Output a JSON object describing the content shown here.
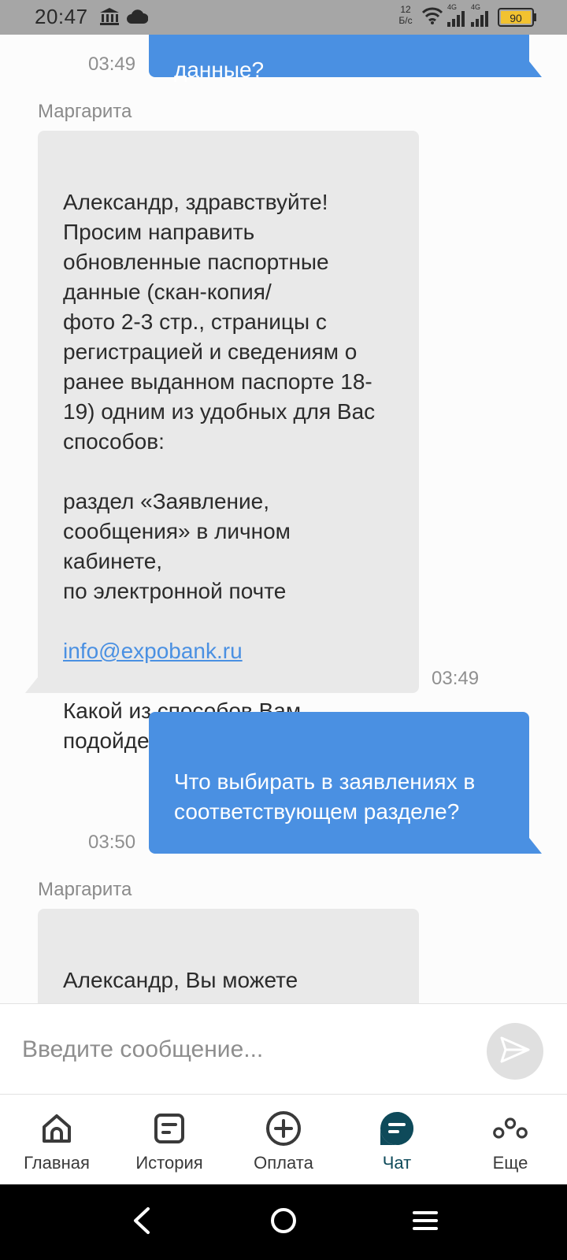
{
  "status_bar": {
    "time": "20:47",
    "net_speed_value": "12",
    "net_speed_unit": "Б/с",
    "net_type_1": "4G",
    "net_type_2": "4G",
    "battery": "90"
  },
  "messages": [
    {
      "id": "m1",
      "direction": "out",
      "text": "данные?",
      "time": "03:49"
    },
    {
      "id": "m2",
      "direction": "in",
      "sender": "Маргарита",
      "text_part1": "Александр, здравствуйте!\nПросим направить обновленные паспортные данные (скан-копия/\nфото 2-3 стр., страницы с регистрацией и сведениям о ранее выданном паспорте 18-19) одним из удобных для Вас способов:\n\nраздел «Заявление, сообщения» в личном кабинете,\nпо электронной почте",
      "link": "info@expobank.ru",
      "text_part2": "Какой из способов Вам подойдет больше?",
      "time": "03:49"
    },
    {
      "id": "m3",
      "direction": "out",
      "text": "Что выбирать в заявлениях в соответствующем разделе?",
      "time": "03:50"
    },
    {
      "id": "m4",
      "direction": "in",
      "sender": "Маргарита",
      "text": "Александр, Вы можете направить через"
    }
  ],
  "composer": {
    "placeholder": "Введите сообщение..."
  },
  "nav": {
    "items": [
      {
        "label": "Главная",
        "icon": "home-icon"
      },
      {
        "label": "История",
        "icon": "history-icon"
      },
      {
        "label": "Оплата",
        "icon": "plus-circle-icon"
      },
      {
        "label": "Чат",
        "icon": "chat-icon",
        "active": true
      },
      {
        "label": "Еще",
        "icon": "more-icon"
      }
    ]
  },
  "colors": {
    "outgoing_bubble": "#4a90e2",
    "incoming_bubble": "#e9e9e9",
    "accent_active": "#0e4a5a"
  }
}
